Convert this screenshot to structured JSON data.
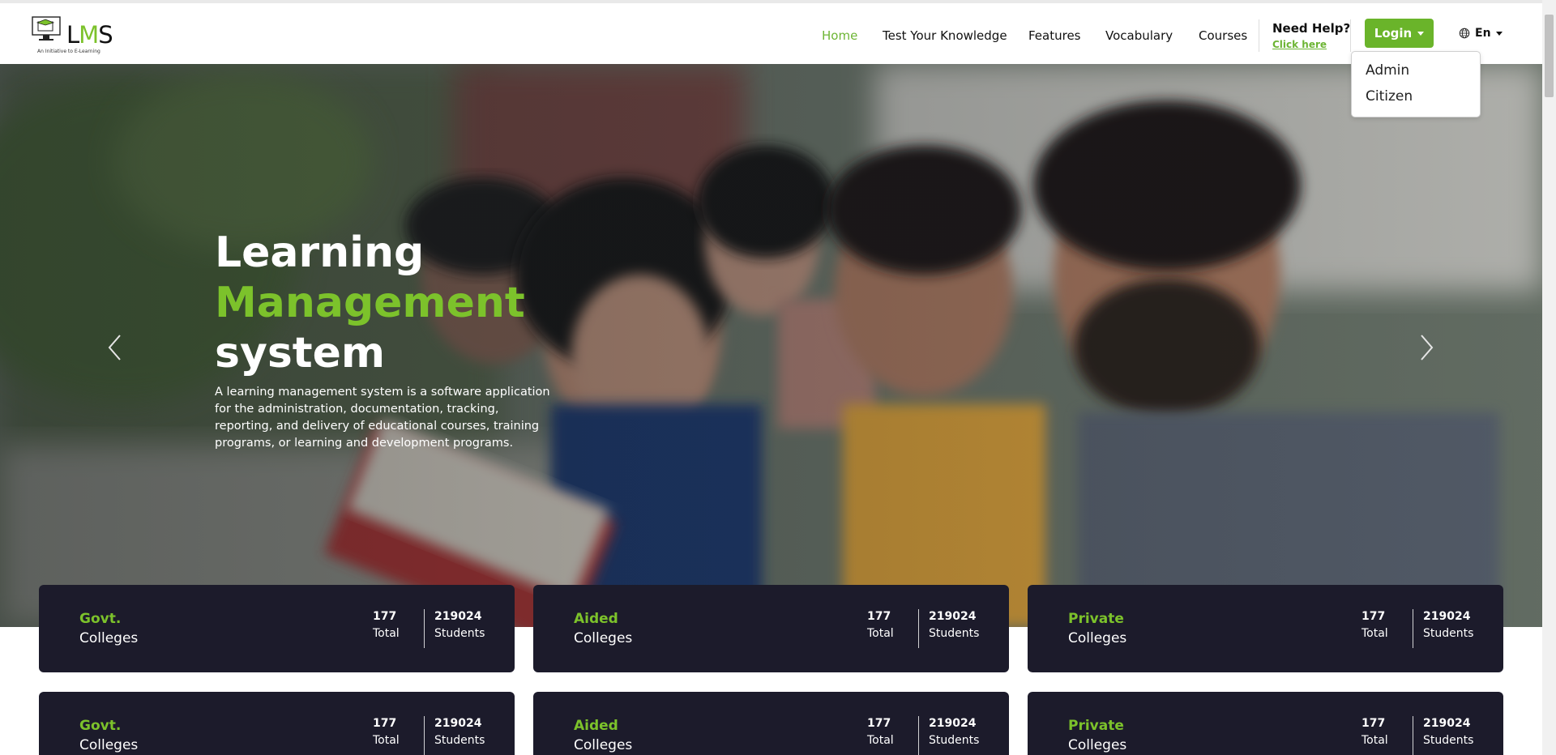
{
  "header": {
    "logo": {
      "name": "LMS",
      "letters": [
        "L",
        "M",
        "S"
      ],
      "tagline": "An Initiative to E-Learning"
    },
    "nav": [
      {
        "label": "Home",
        "active": true
      },
      {
        "label": "Test Your Knowledge",
        "active": false
      },
      {
        "label": "Features",
        "active": false
      },
      {
        "label": "Vocabulary",
        "active": false
      },
      {
        "label": "Courses",
        "active": false
      }
    ],
    "help": {
      "title": "Need Help?",
      "link": "Click here"
    },
    "login": {
      "label": "Login",
      "menu": [
        "Admin",
        "Citizen"
      ]
    },
    "language": {
      "label": "En",
      "icon": "globe-icon"
    }
  },
  "hero": {
    "title_line1": "Learning",
    "title_line2": "Management",
    "title_line3": "system",
    "description": "A learning management system is a software application for the administration, documentation, tracking, reporting, and delivery of educational courses, training programs, or learning and development programs.",
    "prev_icon": "chevron-left-icon",
    "next_icon": "chevron-right-icon"
  },
  "stats": [
    {
      "kind": "Govt.",
      "sub": "Colleges",
      "total": "177",
      "total_label": "Total",
      "students": "219024",
      "students_label": "Students"
    },
    {
      "kind": "Aided",
      "sub": "Colleges",
      "total": "177",
      "total_label": "Total",
      "students": "219024",
      "students_label": "Students"
    },
    {
      "kind": "Private",
      "sub": "Colleges",
      "total": "177",
      "total_label": "Total",
      "students": "219024",
      "students_label": "Students"
    },
    {
      "kind": "Govt.",
      "sub": "Colleges",
      "total": "177",
      "total_label": "Total",
      "students": "219024",
      "students_label": "Students"
    },
    {
      "kind": "Aided",
      "sub": "Colleges",
      "total": "177",
      "total_label": "Total",
      "students": "219024",
      "students_label": "Students"
    },
    {
      "kind": "Private",
      "sub": "Colleges",
      "total": "177",
      "total_label": "Total",
      "students": "219024",
      "students_label": "Students"
    }
  ],
  "colors": {
    "accent": "#6ab42a",
    "card_bg": "#1c1b2b",
    "nav_active": "#6db534"
  }
}
